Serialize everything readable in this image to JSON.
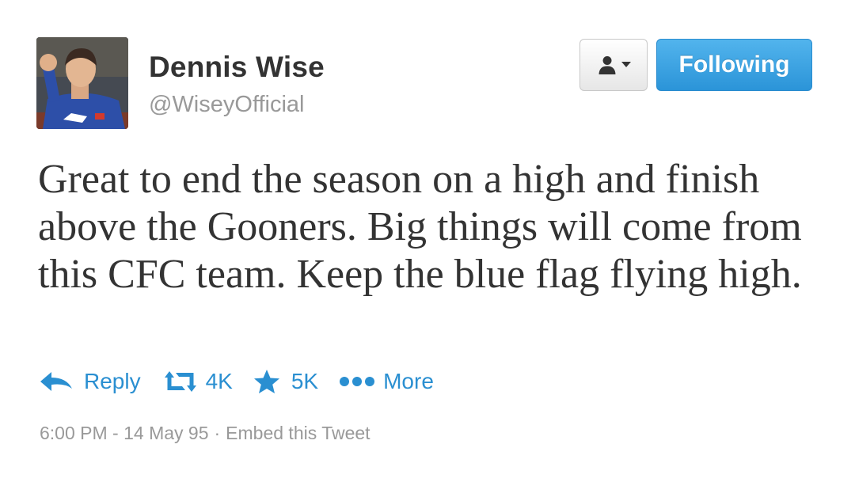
{
  "author": {
    "name": "Dennis Wise",
    "handle": "@WiseyOfficial"
  },
  "header_buttons": {
    "user_menu_icon": "user-dropdown-icon",
    "follow_label": "Following"
  },
  "tweet": {
    "text": "Great to end the season on a high and finish above the Gooners. Big things will come from this CFC team. Keep the blue flag flying high."
  },
  "actions": {
    "reply_label": "Reply",
    "retweet_count": "4K",
    "favorite_count": "5K",
    "more_label": "More"
  },
  "meta": {
    "timestamp": "6:00 PM - 14 May 95",
    "separator": "·",
    "embed_label": "Embed this Tweet"
  },
  "colors": {
    "accent": "#2a8fd1",
    "follow_button": "#3ea3e3",
    "text": "#333333",
    "muted": "#999999"
  }
}
